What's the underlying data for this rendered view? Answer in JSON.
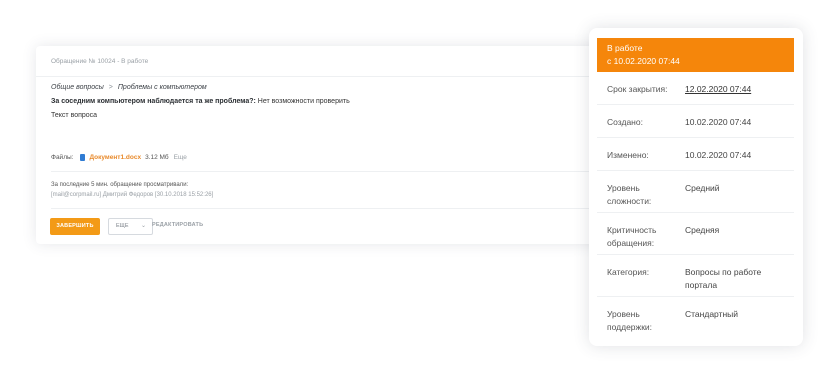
{
  "ticket": {
    "header": "Обращение № 10024 - В работе",
    "breadcrumb": {
      "category": "Общие вопросы",
      "separator": ">",
      "subcategory": "Проблемы с компьютером"
    },
    "question_label": "За соседним компьютером наблюдается та же проблема?:",
    "question_answer": "Нет возможности проверить",
    "question_text": "Текст вопроса",
    "files": {
      "label": "Файлы:",
      "file_name": "Документ1.docx",
      "file_size": "3.12 Мб",
      "more": "Еще"
    },
    "viewers": {
      "title": "За последние 5 мин. обращение просматривали:",
      "entry": "[mail@corpmail.ru] Дмитрий Федоров [30.10.2018 15:52:26]"
    },
    "buttons": {
      "finish": "ЗАВЕРШИТЬ",
      "more": "ЕЩЕ",
      "edit": "РЕДАКТИРОВАТЬ"
    }
  },
  "info": {
    "status": "В работе",
    "status_since": "с 10.02.2020 07:44",
    "rows": [
      {
        "key": "Срок закрытия:",
        "value": "12.02.2020 07:44"
      },
      {
        "key": "Создано:",
        "value": "10.02.2020 07:44"
      },
      {
        "key": "Изменено:",
        "value": "10.02.2020 07:44"
      },
      {
        "key": "Уровень сложности:",
        "value": "Средний"
      },
      {
        "key": "Критичность обращения:",
        "value": "Средняя"
      },
      {
        "key": "Категория:",
        "value": "Вопросы по работе портала"
      },
      {
        "key": "Уровень поддержки:",
        "value": "Стандартный"
      }
    ]
  },
  "colors": {
    "accent": "#f5860b",
    "file_link": "#e8892a",
    "file_icon": "#2f7bd3"
  }
}
